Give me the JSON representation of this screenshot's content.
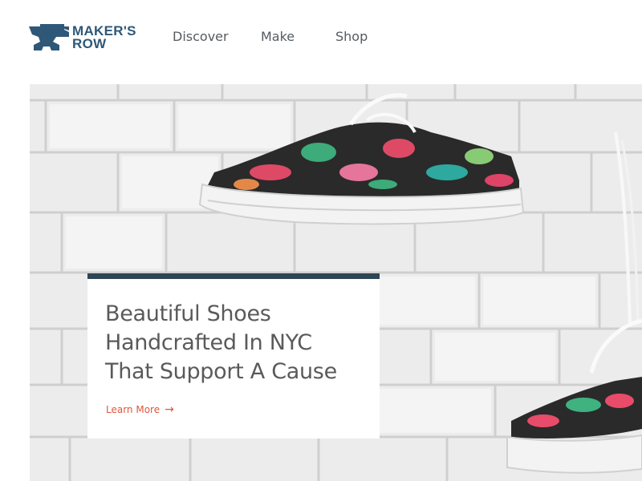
{
  "brand": {
    "line1": "MAKER'S",
    "line2": "ROW",
    "color": "#2f5878"
  },
  "nav": {
    "items": [
      {
        "label": "Discover"
      },
      {
        "label": "Make"
      },
      {
        "label": "Shop"
      }
    ]
  },
  "hero": {
    "image": "floral-sneakers-on-white-brick-wall",
    "card": {
      "title_lines": [
        "Beautiful Shoes",
        "Handcrafted In NYC",
        "That Support A Cause"
      ],
      "cta_label": "Learn More",
      "cta_icon": "arrow-right-icon",
      "accent_color": "#e0553a",
      "bar_color": "#2e4556"
    }
  }
}
